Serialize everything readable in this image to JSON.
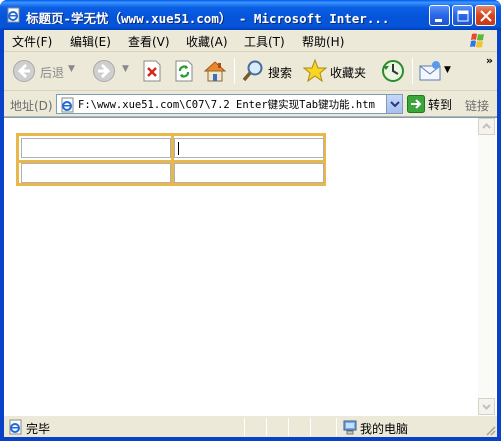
{
  "window": {
    "title": "标题页-学无忧（www.xue51.com） - Microsoft Inter..."
  },
  "menu": {
    "items": [
      "文件(F)",
      "编辑(E)",
      "查看(V)",
      "收藏(A)",
      "工具(T)",
      "帮助(H)"
    ]
  },
  "toolbar": {
    "back_label": "后退",
    "search_label": "搜索",
    "favorites_label": "收藏夹",
    "more_label": "»"
  },
  "address": {
    "label": "地址(D)",
    "url": "F:\\www.xue51.com\\C07\\7.2  Enter键实现Tab键功能.htm",
    "go_label": "转到",
    "links_label": "链接"
  },
  "statusbar": {
    "status": "完毕",
    "zone": "我的电脑"
  },
  "colors": {
    "title_bar": "#0553d8",
    "chrome": "#ece9d8",
    "table_border": "#e8b84a"
  }
}
